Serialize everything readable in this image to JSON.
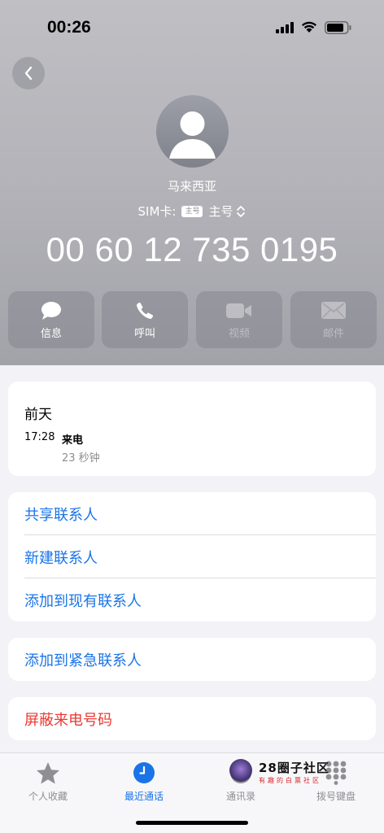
{
  "status_bar": {
    "time": "00:26"
  },
  "contact": {
    "location": "马来西亚",
    "sim_prefix": "SIM卡:",
    "sim_badge": "主号",
    "sim_label": "主号",
    "phone_number": "00 60 12 735 0195"
  },
  "actions": [
    {
      "label": "信息",
      "icon": "message-icon",
      "enabled": true
    },
    {
      "label": "呼叫",
      "icon": "phone-icon",
      "enabled": true
    },
    {
      "label": "视频",
      "icon": "video-icon",
      "enabled": false
    },
    {
      "label": "邮件",
      "icon": "mail-icon",
      "enabled": false
    }
  ],
  "recent": {
    "date": "前天",
    "time": "17:28",
    "type": "来电",
    "duration": "23 秒钟"
  },
  "contact_actions": {
    "share": "共享联系人",
    "new_contact": "新建联系人",
    "add_existing": "添加到现有联系人",
    "add_emergency": "添加到紧急联系人",
    "block": "屏蔽来电号码"
  },
  "tabs": [
    {
      "label": "个人收藏",
      "icon": "star-icon",
      "active": false
    },
    {
      "label": "最近通话",
      "icon": "clock-icon",
      "active": true
    },
    {
      "label": "通讯录",
      "icon": "contacts-icon",
      "active": false
    },
    {
      "label": "拨号键盘",
      "icon": "keypad-icon",
      "active": false
    }
  ],
  "watermark": {
    "title": "28圈子社区",
    "subtitle": "有趣的白票社区"
  },
  "colors": {
    "accent": "#1a74e8",
    "danger": "#ea3a32",
    "header_top": "#bfbfc4",
    "header_bottom": "#a2a2a9"
  }
}
